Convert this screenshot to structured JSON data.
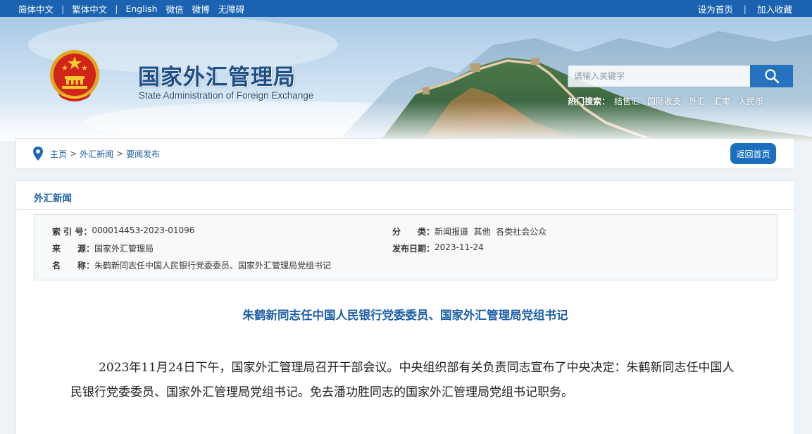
{
  "topbar": {
    "left_links": [
      "简体中文",
      "繁体中文",
      "English",
      "微信",
      "微博",
      "无障碍"
    ],
    "right_links": [
      "设为首页",
      "加入收藏"
    ]
  },
  "header": {
    "title": "国家外汇管理局",
    "subtitle": "State Administration of Foreign Exchange",
    "emblem_icon": "national-emblem-icon",
    "search_placeholder": "请输入关键字",
    "search_icon": "search-icon",
    "hot_label": "热门搜索：",
    "hot_items": [
      "结售汇",
      "国际收支",
      "外汇",
      "汇率",
      "人民币"
    ]
  },
  "breadcrumb": {
    "icon": "location-pin-icon",
    "items": [
      "主页",
      "外汇新闻",
      "要闻发布"
    ],
    "separator": ">",
    "back_label": "返回首页"
  },
  "section": {
    "title": "外汇新闻"
  },
  "meta": {
    "index_label": "索 引 号：",
    "index_value": "000014453-2023-01096",
    "source_label": "来　　源：",
    "source_value": "国家外汇管理局",
    "name_label": "名　　称：",
    "name_value": "朱鹤新同志任中国人民银行党委委员、国家外汇管理局党组书记",
    "category_label": "分　　类：",
    "category_value": "新闻报道  其他  各类社会公众",
    "date_label": "发布日期：",
    "date_value": "2023-11-24"
  },
  "article": {
    "title": "朱鹤新同志任中国人民银行党委委员、国家外汇管理局党组书记",
    "body": "2023年11月24日下午，国家外汇管理局召开干部会议。中央组织部有关负责同志宣布了中央决定：朱鹤新同志任中国人民银行党委委员、国家外汇管理局党组书记。免去潘功胜同志的国家外汇管理局党组书记职务。"
  },
  "colors": {
    "brand_blue": "#1b63b0",
    "link_blue": "#1d5fa8",
    "title_blue": "#1e4f86"
  }
}
